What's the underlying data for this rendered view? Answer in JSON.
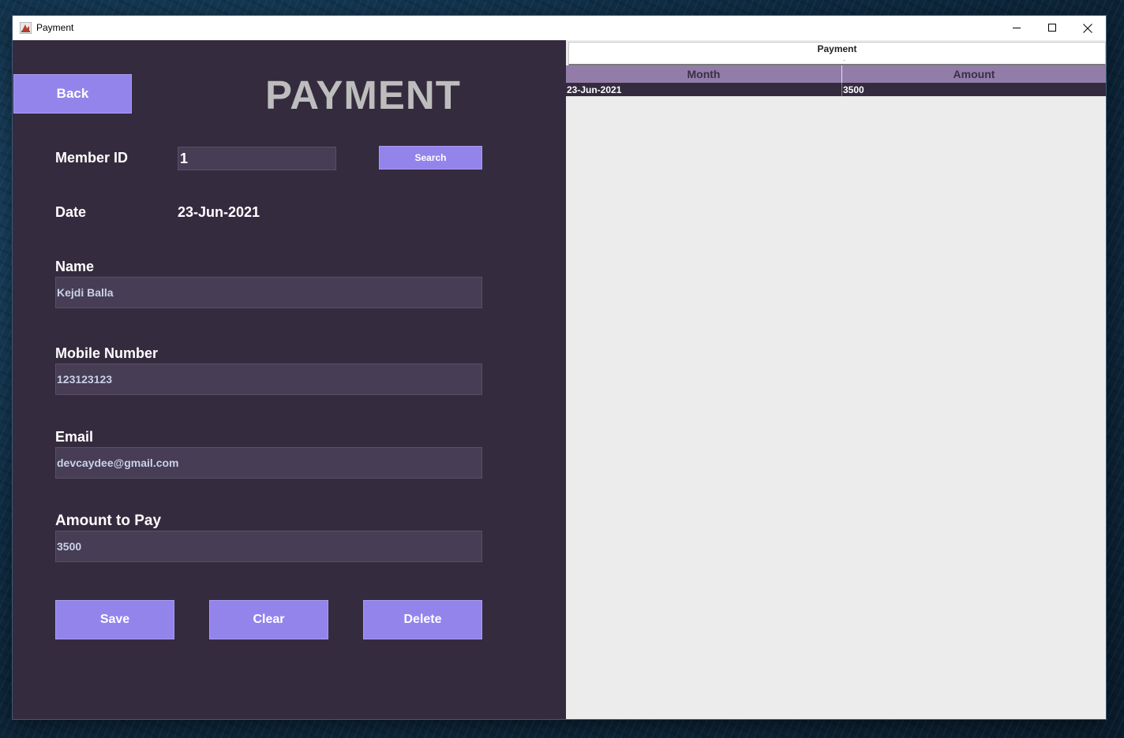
{
  "window": {
    "title": "Payment",
    "controls": {
      "minimize": "–",
      "maximize": "☐",
      "close": "✕"
    }
  },
  "form": {
    "back_label": "Back",
    "heading": "PAYMENT",
    "member_id_label": "Member ID",
    "member_id_value": "1",
    "search_label": "Search",
    "date_label": "Date",
    "date_value": "23-Jun-2021",
    "name_label": "Name",
    "name_value": "Kejdi Balla",
    "mobile_label": "Mobile Number",
    "mobile_value": "123123123",
    "email_label": "Email",
    "email_value": "devcaydee@gmail.com",
    "amount_label": "Amount to Pay",
    "amount_value": "3500",
    "save_label": "Save",
    "clear_label": "Clear",
    "delete_label": "Delete"
  },
  "table": {
    "caption": "Payment",
    "columns": [
      "Month",
      "Amount"
    ],
    "rows": [
      [
        "23-Jun-2021",
        "3500"
      ]
    ]
  },
  "colors": {
    "panel_bg": "#352b3e",
    "accent": "#9384ec",
    "field_bg": "#473d54",
    "table_header": "#927da8",
    "right_bg": "#ececec"
  }
}
